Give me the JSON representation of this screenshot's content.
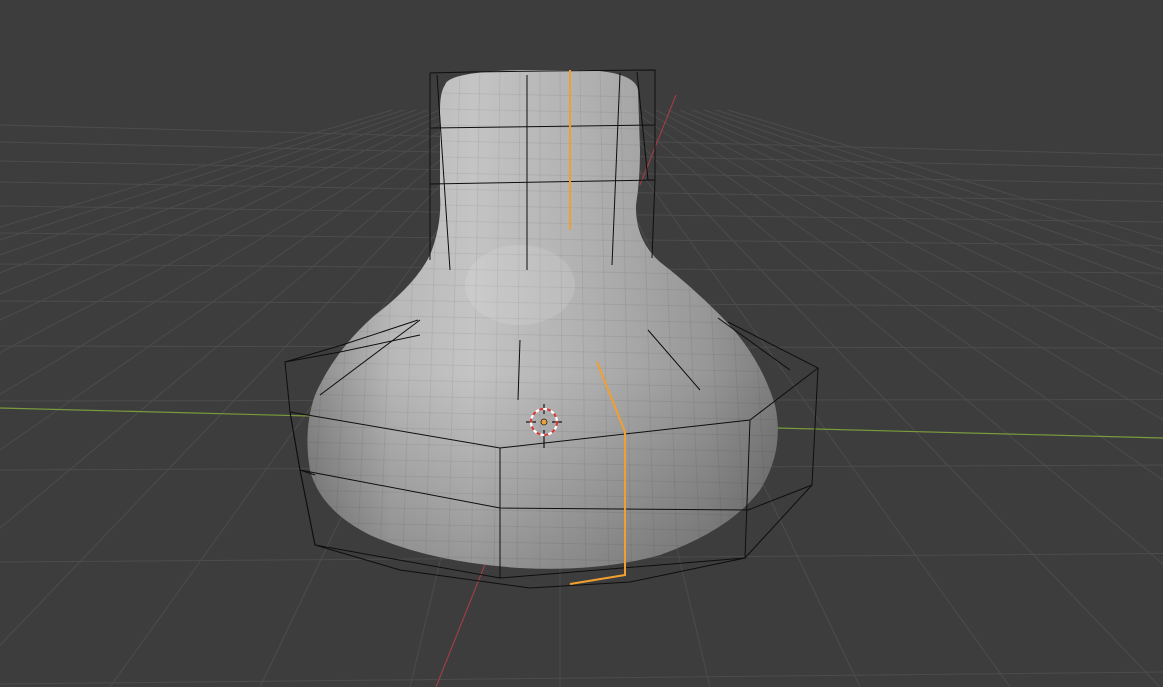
{
  "app": "3D viewport",
  "viewport": {
    "background_color": "#3d3d3d",
    "grid_color": "#4c4c4c",
    "x_axis_color": "#7a9c3c",
    "y_axis_color": "#9b3e46",
    "cage_color": "#0e0e0e",
    "selected_edge_color": "#f0a030",
    "mesh_color": "#a8a8a8",
    "object": {
      "type": "subdivision-mesh",
      "shape": "bottle",
      "selected": true
    },
    "cursor": {
      "icon": "3d-cursor-icon"
    }
  }
}
